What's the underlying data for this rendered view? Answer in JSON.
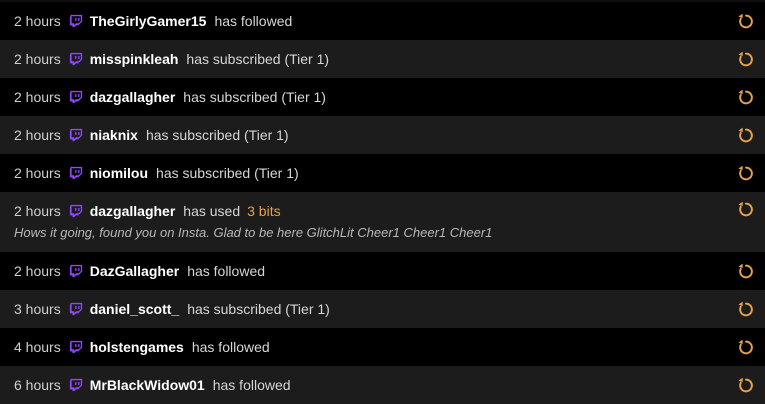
{
  "colors": {
    "twitch_purple": "#9147ff",
    "replay_orange": "#e6a24a",
    "bits_orange": "#e6a24a"
  },
  "icons": {
    "platform": "twitch-icon",
    "replay": "replay-icon"
  },
  "events": [
    {
      "time": "2 hours",
      "user": "TheGirlyGamer15",
      "action": "has followed"
    },
    {
      "time": "2 hours",
      "user": "misspinkleah",
      "action": "has subscribed (Tier 1)"
    },
    {
      "time": "2 hours",
      "user": "dazgallagher",
      "action": "has subscribed (Tier 1)"
    },
    {
      "time": "2 hours",
      "user": "niaknix",
      "action": "has subscribed (Tier 1)"
    },
    {
      "time": "2 hours",
      "user": "niomilou",
      "action": "has subscribed (Tier 1)"
    },
    {
      "time": "2 hours",
      "user": "dazgallagher",
      "action": "has used",
      "bits": "3 bits",
      "message": "Hows it going, found you on Insta. Glad to be here GlitchLit Cheer1 Cheer1 Cheer1"
    },
    {
      "time": "2 hours",
      "user": "DazGallagher",
      "action": "has followed"
    },
    {
      "time": "3 hours",
      "user": "daniel_scott_",
      "action": "has subscribed (Tier 1)"
    },
    {
      "time": "4 hours",
      "user": "holstengames",
      "action": "has followed"
    },
    {
      "time": "6 hours",
      "user": "MrBlackWidow01",
      "action": "has followed"
    }
  ]
}
